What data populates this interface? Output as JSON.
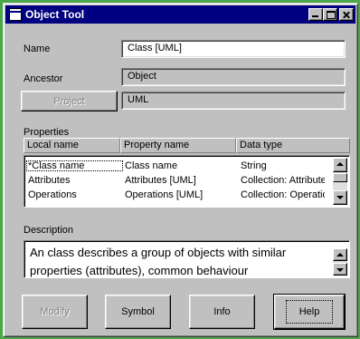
{
  "window": {
    "title": "Object Tool"
  },
  "form": {
    "name_label": "Name",
    "name_value": "Class [UML]",
    "ancestor_label": "Ancestor",
    "ancestor_value": "Object",
    "project_button": "Project",
    "project_value": "UML"
  },
  "properties": {
    "label": "Properties",
    "columns": [
      "Local name",
      "Property name",
      "Data type"
    ],
    "rows": [
      [
        "*Class name",
        "Class name",
        "String"
      ],
      [
        "Attributes",
        "Attributes [UML]",
        "Collection: Attribute"
      ],
      [
        "Operations",
        "Operations [UML]",
        "Collection: Operatio"
      ]
    ]
  },
  "description": {
    "label": "Description",
    "text": "An class describes a group of objects with similar\nproperties (attributes), common behaviour"
  },
  "buttons": {
    "modify": "Modify",
    "symbol": "Symbol",
    "info": "Info",
    "help": "Help"
  },
  "icons": {
    "app": "window-icon",
    "minimize": "minimize-icon",
    "maximize": "maximize-icon",
    "close": "close-icon"
  }
}
